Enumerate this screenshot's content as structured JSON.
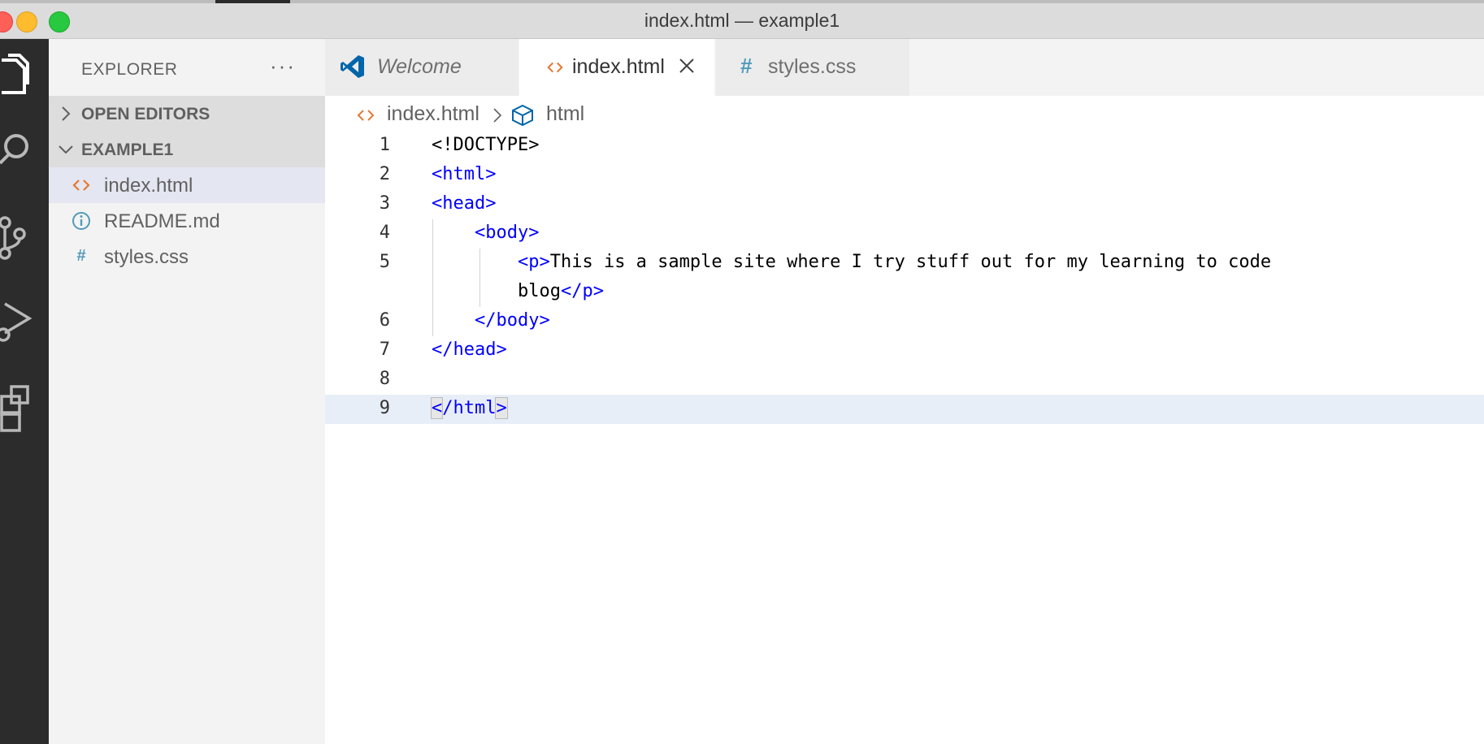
{
  "window": {
    "title": "index.html — example1"
  },
  "activity_bar": {
    "items": [
      "files-icon",
      "search-icon",
      "source-control-icon",
      "run-debug-icon",
      "extensions-icon"
    ]
  },
  "sidebar": {
    "title": "EXPLORER",
    "more": "···",
    "sections": [
      {
        "label": "OPEN EDITORS",
        "expanded": false
      },
      {
        "label": "EXAMPLE1",
        "expanded": true
      }
    ],
    "files": [
      {
        "name": "index.html",
        "icon": "html-file-icon",
        "active": true
      },
      {
        "name": "README.md",
        "icon": "info-icon",
        "active": false
      },
      {
        "name": "styles.css",
        "icon": "css-file-icon",
        "active": false
      }
    ]
  },
  "tabs": [
    {
      "label": "Welcome",
      "icon": "vscode-logo-icon",
      "active": false,
      "preview": true
    },
    {
      "label": "index.html",
      "icon": "html-file-icon",
      "active": true
    },
    {
      "label": "styles.css",
      "icon": "css-file-icon",
      "active": false
    }
  ],
  "breadcrumb": [
    {
      "label": "index.html",
      "icon": "html-file-icon"
    },
    {
      "label": "html",
      "icon": "element-cube-icon"
    }
  ],
  "editor": {
    "current_line": 9,
    "lines": [
      {
        "n": "1",
        "text": "<!DOCTYPE>"
      },
      {
        "n": "2",
        "text": "<html>"
      },
      {
        "n": "3",
        "text": "<head>"
      },
      {
        "n": "4",
        "text": "    <body>"
      },
      {
        "n": "5",
        "text": "        <p>This is a sample site where I try stuff out for my learning to code"
      },
      {
        "n": "",
        "text": "        blog</p>"
      },
      {
        "n": "6",
        "text": "    </body>"
      },
      {
        "n": "7",
        "text": "</head>"
      },
      {
        "n": "8",
        "text": ""
      },
      {
        "n": "9",
        "text": "</html>"
      }
    ]
  },
  "colors": {
    "activity_bar": "#2c2c2c",
    "sidebar": "#f3f3f3",
    "tag": "#0000ff",
    "html_icon": "#e37933",
    "css_icon": "#519aba",
    "vscode_blue": "#0065a9"
  }
}
